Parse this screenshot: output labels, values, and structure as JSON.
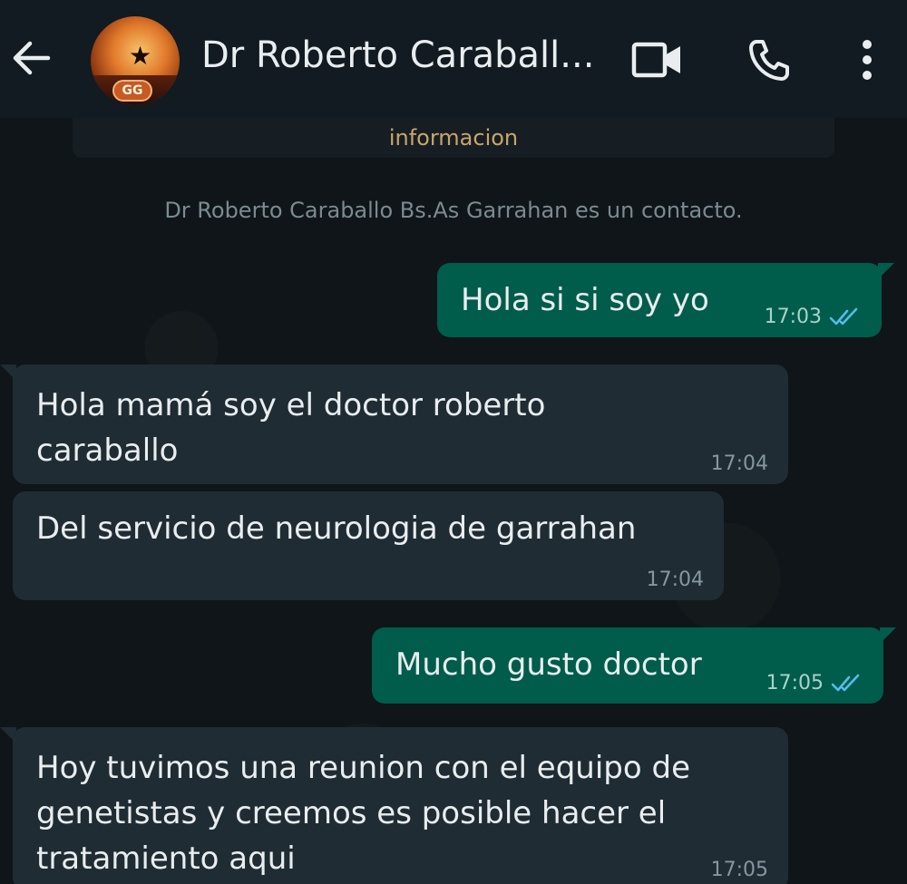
{
  "header": {
    "contact_name": "Dr Roberto Caraball...",
    "avatar_badge": "GG",
    "icons": {
      "back": "arrow-left-icon",
      "video": "video-camera-icon",
      "call": "phone-icon",
      "menu": "more-vertical-icon"
    }
  },
  "chat": {
    "info_strip": "informacion",
    "system_message": "Dr Roberto Caraballo Bs.As Garrahan es un contacto.",
    "messages": [
      {
        "direction": "out",
        "text": "Hola si si soy yo",
        "time": "17:03",
        "status": "read"
      },
      {
        "direction": "in",
        "text": "Hola mamá soy el doctor roberto caraballo",
        "time": "17:04"
      },
      {
        "direction": "in",
        "text": "Del servicio de neurologia de garrahan",
        "time": "17:04"
      },
      {
        "direction": "out",
        "text": "Mucho gusto doctor",
        "time": "17:05",
        "status": "read"
      },
      {
        "direction": "in",
        "text": "Hoy tuvimos una reunion con el equipo de genetistas y creemos es posible hacer el tratamiento aqui",
        "time": "17:05"
      }
    ]
  },
  "colors": {
    "header_bg": "#111b21",
    "outgoing_bubble": "#005c4b",
    "incoming_bubble": "#1f2c33",
    "read_ticks": "#53bdeb",
    "info_text": "#c9a56a"
  }
}
